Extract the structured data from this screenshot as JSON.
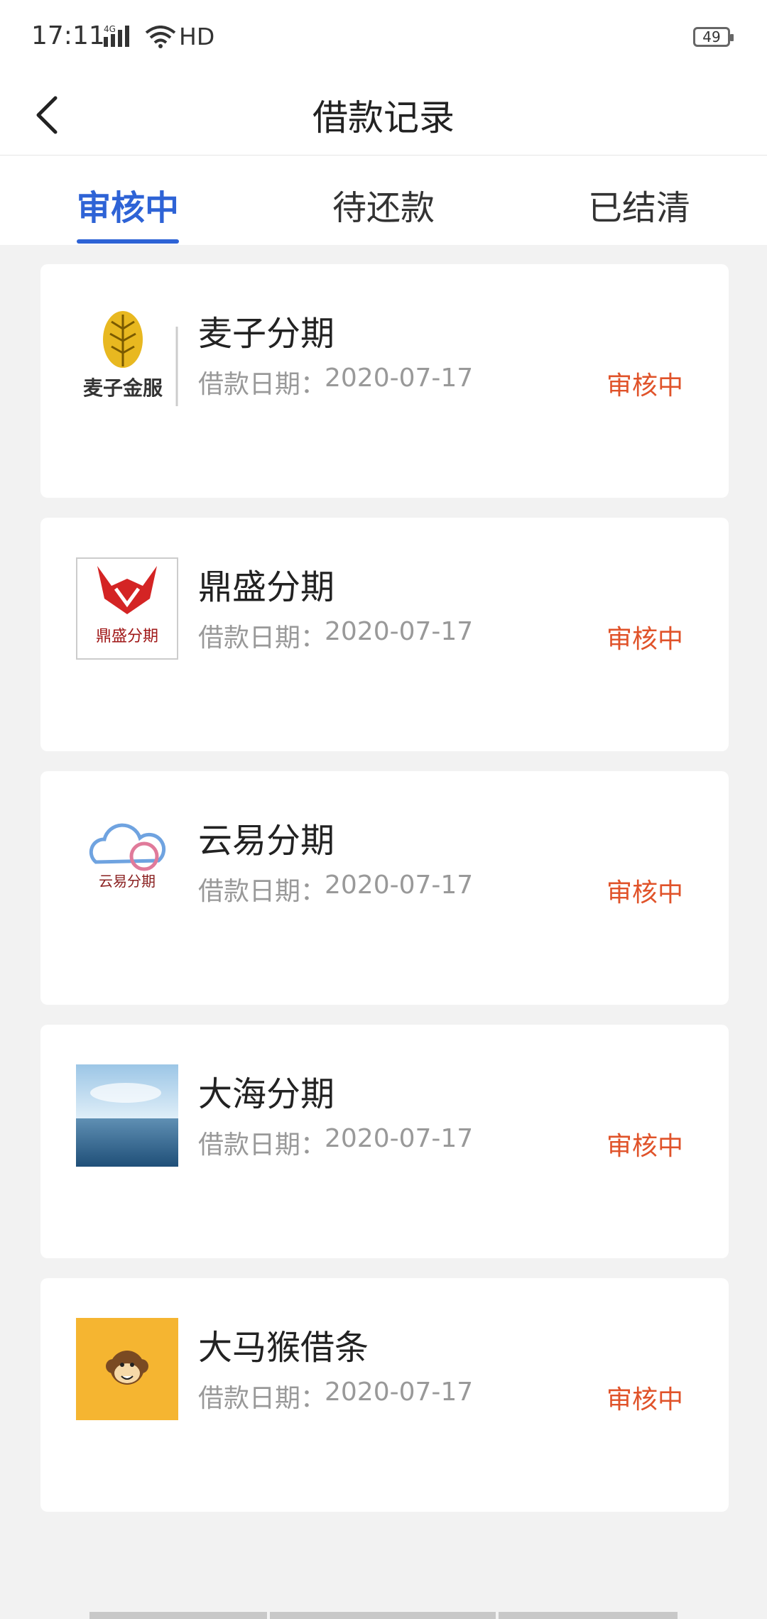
{
  "status_bar": {
    "time": "17:11",
    "network": "4G",
    "hd": "HD",
    "battery": "49"
  },
  "navbar": {
    "title": "借款记录",
    "back_icon": "chevron-left-icon"
  },
  "tabs": [
    {
      "label": "审核中",
      "active": true
    },
    {
      "label": "待还款",
      "active": false
    },
    {
      "label": "已结清",
      "active": false
    }
  ],
  "date_label": "借款日期：",
  "loans": [
    {
      "name": "麦子分期",
      "date": "2020-07-17",
      "status": "审核中",
      "logo": "maizi-logo",
      "logo_text": "麦子金服"
    },
    {
      "name": "鼎盛分期",
      "date": "2020-07-17",
      "status": "审核中",
      "logo": "dingsheng-logo",
      "logo_text": "鼎盛分期"
    },
    {
      "name": "云易分期",
      "date": "2020-07-17",
      "status": "审核中",
      "logo": "yunyi-logo",
      "logo_text": "云易分期"
    },
    {
      "name": "大海分期",
      "date": "2020-07-17",
      "status": "审核中",
      "logo": "sea-logo"
    },
    {
      "name": "大马猴借条",
      "date": "2020-07-17",
      "status": "审核中",
      "logo": "monkey-logo"
    }
  ],
  "colors": {
    "accent": "#2e63d6",
    "status": "#e0532a",
    "background": "#f2f2f2"
  }
}
